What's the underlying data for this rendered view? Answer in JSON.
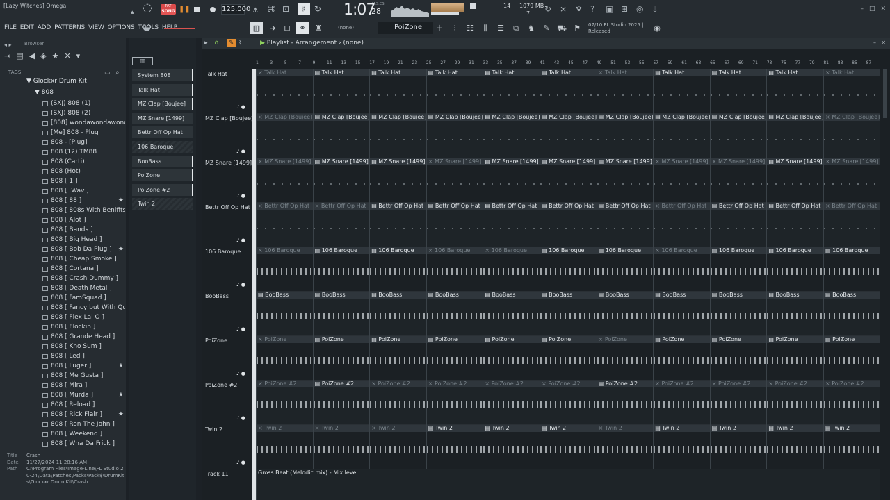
{
  "window": {
    "title": "[Lazy Witches] Omega",
    "controls": [
      "–",
      "□",
      "✕"
    ]
  },
  "menu": [
    "FILE",
    "EDIT",
    "ADD",
    "PATTERNS",
    "VIEW",
    "OPTIONS",
    "TOOLS",
    "HELP"
  ],
  "transport": {
    "pat_label": "PAT",
    "song_label": "SONG",
    "tempo": "125.000",
    "time_main": "1:07",
    "time_sub": "28",
    "time_unit": "M:S:CS",
    "cpu": "14",
    "memory": "1079 MB",
    "polyphony": "7"
  },
  "toolbar": {
    "pattern_name": "PoiZone",
    "arrangement_none": "(none)",
    "news": "07/10  FL Studio 2025 | Released"
  },
  "browser": {
    "title": "Browser",
    "tags_label": "TAGS",
    "root": "Glockxr Drum Kit",
    "folder": "808",
    "files": [
      {
        "name": "(SXJ) 808 (1)",
        "star": false
      },
      {
        "name": "(SXJ) 808 (2)",
        "star": false
      },
      {
        "name": "[808] wondawondawonda",
        "star": false
      },
      {
        "name": "[Me] 808 - Plug",
        "star": false
      },
      {
        "name": "808 - [Plug]",
        "star": false
      },
      {
        "name": "808 (12) TM88",
        "star": false
      },
      {
        "name": "808 (Carti)",
        "star": false
      },
      {
        "name": "808 (Hot)",
        "star": false
      },
      {
        "name": "808 [ 1 ]",
        "star": false
      },
      {
        "name": "808 [ .Wav ]",
        "star": false
      },
      {
        "name": "808 [ 88 ]",
        "star": true
      },
      {
        "name": "808 [ 808s With Benifits ]",
        "star": false
      },
      {
        "name": "808 [ Alot ]",
        "star": false
      },
      {
        "name": "808 [ Bands ]",
        "star": false
      },
      {
        "name": "808 [ Big Head ]",
        "star": false
      },
      {
        "name": "808 [ Bob Da Plug ]",
        "star": true
      },
      {
        "name": "808 [ Cheap Smoke ]",
        "star": false
      },
      {
        "name": "808 [ Cortana ]",
        "star": false
      },
      {
        "name": "808 [ Crash Dummy ]",
        "star": false
      },
      {
        "name": "808 [ Death Metal ]",
        "star": false
      },
      {
        "name": "808 [ FamSquad ]",
        "star": false
      },
      {
        "name": "808 [ Fancy but With Quavo ]",
        "star": false
      },
      {
        "name": "808 [ Flex Lai O ]",
        "star": false
      },
      {
        "name": "808 [ Flockin ]",
        "star": false
      },
      {
        "name": "808 [ Grande Head ]",
        "star": false
      },
      {
        "name": "808 [ Kno Sum ]",
        "star": false
      },
      {
        "name": "808 [ Led ]",
        "star": false
      },
      {
        "name": "808 [ Luger ]",
        "star": true
      },
      {
        "name": "808 [ Me Gusta ]",
        "star": false
      },
      {
        "name": "808 [ Mira ]",
        "star": false
      },
      {
        "name": "808 [ Murda ]",
        "star": true
      },
      {
        "name": "808 [ Reload ]",
        "star": false
      },
      {
        "name": "808 [ Rick Flair ]",
        "star": true
      },
      {
        "name": "808 [ Ron The John ]",
        "star": false
      },
      {
        "name": "808 [ Weekend ]",
        "star": false
      },
      {
        "name": "808 [ Wha Da Frick ]",
        "star": false
      }
    ],
    "info": {
      "title_label": "Title",
      "title": "Crash",
      "date_label": "Date",
      "date": "11/27/2024 11:28:16 AM",
      "path_label": "Path",
      "path": "C:\\Program Files\\Image-Line\\FL Studio 20-24\\Data\\Patches\\Packs\\Pack$\\DrumKits\\Glockxr Drum Kit\\Crash"
    }
  },
  "picker": {
    "items": [
      {
        "name": "System 808",
        "selected": true,
        "hatched": false
      },
      {
        "name": "Talk Hat",
        "selected": true,
        "hatched": false
      },
      {
        "name": "MZ Clap [Boujee]",
        "selected": true,
        "hatched": false
      },
      {
        "name": "MZ Snare [1499]",
        "selected": false,
        "hatched": false
      },
      {
        "name": "Bettr Off Op Hat",
        "selected": false,
        "hatched": false
      },
      {
        "name": "106 Baroque",
        "selected": false,
        "hatched": true
      },
      {
        "name": "BooBass",
        "selected": true,
        "hatched": false
      },
      {
        "name": "PoiZone",
        "selected": true,
        "hatched": false
      },
      {
        "name": "PoiZone #2",
        "selected": true,
        "hatched": false
      },
      {
        "name": "Twin 2",
        "selected": false,
        "hatched": true
      }
    ]
  },
  "playlist": {
    "title": "Playlist - Arrangement",
    "arrangement": "(none)",
    "ruler": [
      "1",
      "3",
      "5",
      "7",
      "9",
      "11",
      "13",
      "15",
      "17",
      "19",
      "21",
      "23",
      "25",
      "27",
      "29",
      "31",
      "33",
      "35",
      "37",
      "39",
      "41",
      "43",
      "45",
      "47",
      "49",
      "51",
      "53",
      "55",
      "57",
      "59",
      "61",
      "63",
      "65",
      "67",
      "69",
      "71",
      "73",
      "75",
      "77",
      "79",
      "81",
      "83",
      "85",
      "87"
    ],
    "tracks": [
      {
        "name": "Talk Hat",
        "clip": "Talk Hat",
        "muted": [
          0,
          6,
          10
        ],
        "notes": "sparse"
      },
      {
        "name": "MZ Clap [Boujee]",
        "clip": "MZ Clap [Boujee]",
        "muted": [
          0,
          10
        ],
        "notes": "sparse"
      },
      {
        "name": "MZ Snare [1499]",
        "clip": "MZ Snare [1499]",
        "muted": [
          0,
          3,
          7,
          8,
          10
        ],
        "notes": "sparse"
      },
      {
        "name": "Bettr Off Op Hat",
        "clip": "Bettr Off Op Hat",
        "muted": [
          0,
          1,
          7,
          10
        ],
        "notes": "sparse"
      },
      {
        "name": "106 Baroque",
        "clip": "106 Baroque",
        "muted": [
          0,
          3,
          4,
          7
        ],
        "notes": "dense"
      },
      {
        "name": "BooBass",
        "clip": "BooBass",
        "muted": [],
        "notes": "dense"
      },
      {
        "name": "PoiZone",
        "clip": "PoiZone",
        "muted": [
          0,
          6
        ],
        "notes": "dense"
      },
      {
        "name": "PoiZone #2",
        "clip": "PoiZone #2",
        "muted": [
          0,
          2,
          3,
          4,
          5,
          7,
          8,
          9,
          10
        ],
        "notes": "dense"
      },
      {
        "name": "Twin 2",
        "clip": "Twin 2",
        "muted": [
          0,
          1,
          2,
          6
        ],
        "notes": "dense"
      },
      {
        "name": "Track 11",
        "clip": "Gross Beat (Melodic mix) - Mix level",
        "muted": [],
        "notes": "none"
      }
    ],
    "poizone2_first": [
      "PoiZ..#2",
      "PoiZ..#2"
    ]
  },
  "colors": {
    "accent": "#e38c30",
    "playhead": "#a82a2a",
    "song_red": "#e35454",
    "play_green": "#8fd15e"
  }
}
